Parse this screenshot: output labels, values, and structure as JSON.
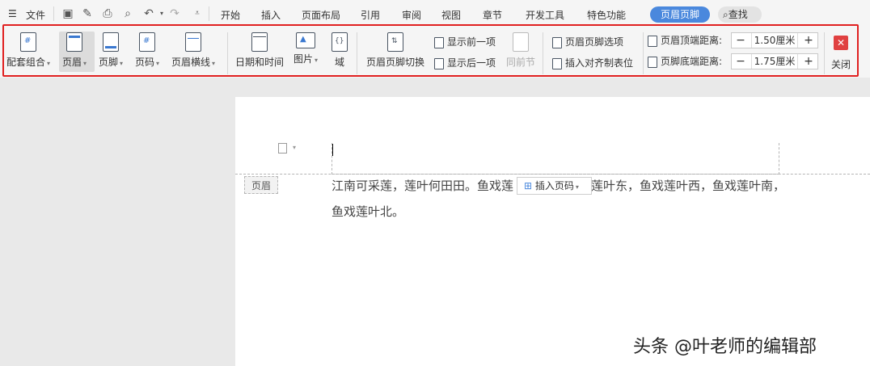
{
  "menubar": {
    "file_label": "文件",
    "tabs": [
      "开始",
      "插入",
      "页面布局",
      "引用",
      "审阅",
      "视图",
      "章节",
      "开发工具",
      "特色功能",
      "页眉页脚"
    ],
    "active_tab": "页眉页脚",
    "search_label": "查找"
  },
  "ribbon": {
    "combo_label": "配套组合",
    "header_label": "页眉",
    "footer_label": "页脚",
    "pagenum_label": "页码",
    "header_line_label": "页眉横线",
    "datetime_label": "日期和时间",
    "picture_label": "图片",
    "field_label": "域",
    "switch_label": "页眉页脚切换",
    "show_prev_label": "显示前一项",
    "show_next_label": "显示后一项",
    "same_prev_label": "同前节",
    "options_label": "页眉页脚选项",
    "insert_align_label": "插入对齐制表位",
    "header_top_label": "页眉顶端距离:",
    "header_top_value": "1.50厘米",
    "footer_bottom_label": "页脚底端距离:",
    "footer_bottom_value": "1.75厘米",
    "close_label": "关闭"
  },
  "document": {
    "header_tag": "页眉",
    "insert_page_number": "插入页码",
    "line1_part1": "江南可采莲，莲叶何田田。鱼戏莲",
    "line1_part2": "莲叶东，鱼戏莲叶西，鱼戏莲叶南，",
    "line2": "鱼戏莲叶北。"
  },
  "watermark": "头条 @叶老师的编辑部",
  "colors": {
    "accent": "#4a88dd",
    "frame": "#e02020",
    "close": "#e04040"
  }
}
